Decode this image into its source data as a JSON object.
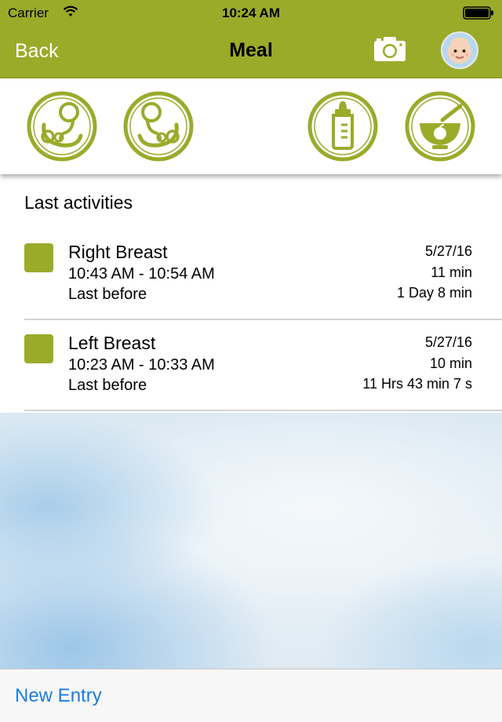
{
  "status_bar": {
    "carrier": "Carrier",
    "time": "10:24 AM"
  },
  "nav": {
    "back_label": "Back",
    "title": "Meal"
  },
  "meal_types": [
    {
      "name": "left-breast-icon"
    },
    {
      "name": "right-breast-icon"
    },
    {
      "name": "baby-bottle-icon"
    },
    {
      "name": "food-bowl-icon"
    }
  ],
  "activities": {
    "header": "Last activities",
    "items": [
      {
        "title": "Right Breast",
        "time_range": "10:43 AM - 10:54 AM",
        "last_label": "Last before",
        "date": "5/27/16",
        "duration": "11 min",
        "since": "1 Day 8 min"
      },
      {
        "title": "Left Breast",
        "time_range": "10:23 AM - 10:33 AM",
        "last_label": "Last before",
        "date": "5/27/16",
        "duration": "10 min",
        "since": "11 Hrs 43 min 7 s"
      }
    ]
  },
  "toolbar": {
    "new_entry_label": "New Entry"
  },
  "colors": {
    "accent_green": "#9aab2a",
    "link_blue": "#1a7de0"
  }
}
